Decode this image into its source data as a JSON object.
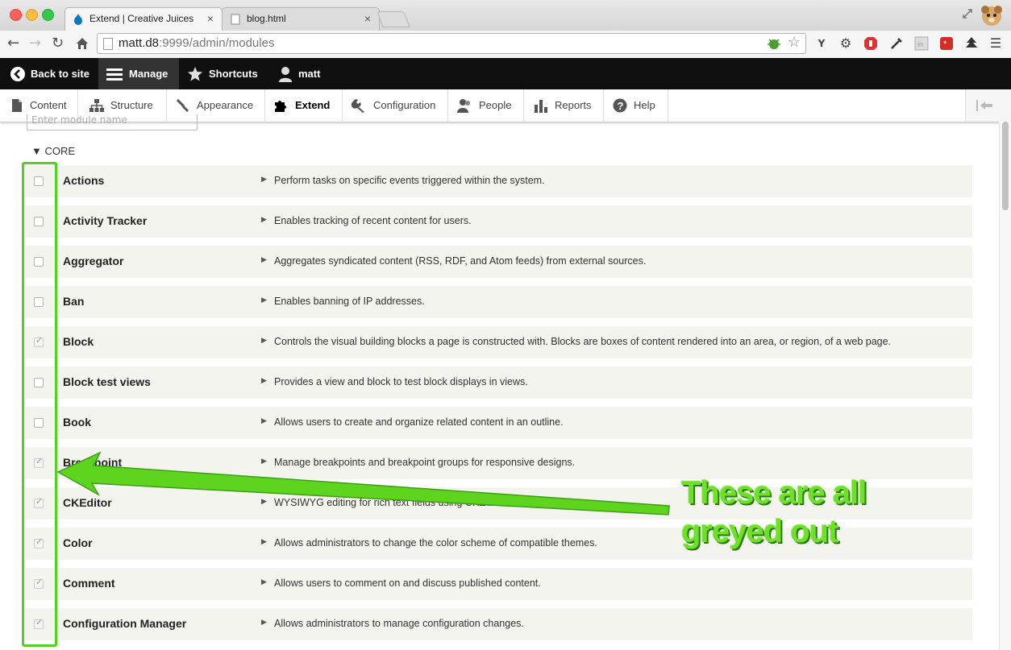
{
  "browser": {
    "tabs": [
      {
        "title": "Extend | Creative Juices",
        "active": true
      },
      {
        "title": "blog.html",
        "active": false
      }
    ],
    "url_host": "matt.d8",
    "url_rest": ":9999/admin/modules"
  },
  "drupal_toolbar": {
    "back_to_site": "Back to site",
    "manage": "Manage",
    "shortcuts": "Shortcuts",
    "user": "matt"
  },
  "tray": {
    "items": [
      {
        "label": "Content",
        "icon": "file-icon"
      },
      {
        "label": "Structure",
        "icon": "sitemap-icon"
      },
      {
        "label": "Appearance",
        "icon": "brush-icon"
      },
      {
        "label": "Extend",
        "icon": "puzzle-icon",
        "active": true
      },
      {
        "label": "Configuration",
        "icon": "wrench-icon"
      },
      {
        "label": "People",
        "icon": "people-icon"
      },
      {
        "label": "Reports",
        "icon": "bar-chart-icon"
      },
      {
        "label": "Help",
        "icon": "help-icon"
      }
    ]
  },
  "filter": {
    "placeholder": "Enter module name"
  },
  "section": {
    "label": "CORE"
  },
  "modules": [
    {
      "name": "Actions",
      "description": "Perform tasks on specific events triggered within the system.",
      "checked": false
    },
    {
      "name": "Activity Tracker",
      "description": "Enables tracking of recent content for users.",
      "checked": false
    },
    {
      "name": "Aggregator",
      "description": "Aggregates syndicated content (RSS, RDF, and Atom feeds) from external sources.",
      "checked": false
    },
    {
      "name": "Ban",
      "description": "Enables banning of IP addresses.",
      "checked": false
    },
    {
      "name": "Block",
      "description": "Controls the visual building blocks a page is constructed with. Blocks are boxes of content rendered into an area, or region, of a web page.",
      "checked": true
    },
    {
      "name": "Block test views",
      "description": "Provides a view and block to test block displays in views.",
      "checked": false
    },
    {
      "name": "Book",
      "description": "Allows users to create and organize related content in an outline.",
      "checked": false
    },
    {
      "name": "Breakpoint",
      "description": "Manage breakpoints and breakpoint groups for responsive designs.",
      "checked": true
    },
    {
      "name": "CKEditor",
      "description": "WYSIWYG editing for rich text fields using CKEditor.",
      "checked": true
    },
    {
      "name": "Color",
      "description": "Allows administrators to change the color scheme of compatible themes.",
      "checked": true
    },
    {
      "name": "Comment",
      "description": "Allows users to comment on and discuss published content.",
      "checked": true
    },
    {
      "name": "Configuration Manager",
      "description": "Allows administrators to manage configuration changes.",
      "checked": true
    }
  ],
  "annotation": {
    "line1": "These are all",
    "line2": "greyed out",
    "color": "#50d21e"
  }
}
